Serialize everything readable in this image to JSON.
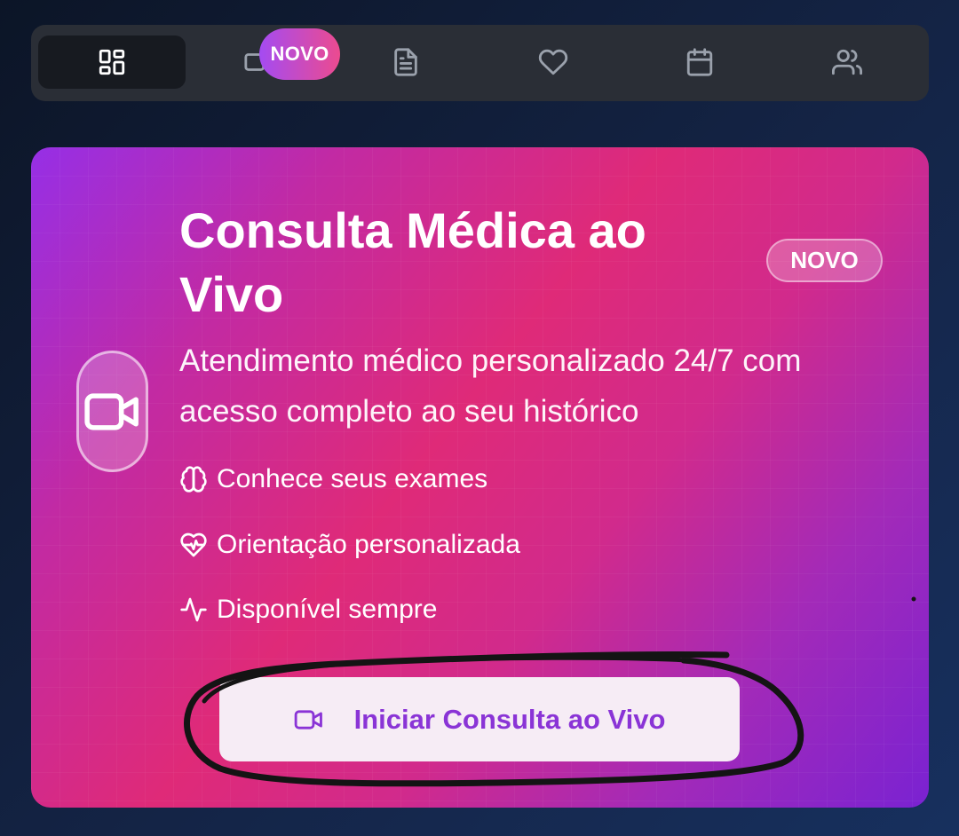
{
  "tabs": [
    {
      "id": "dashboard",
      "icon": "layout-grid-icon"
    },
    {
      "id": "video",
      "icon": "video-icon",
      "badge": "NOVO"
    },
    {
      "id": "documents",
      "icon": "file-text-icon"
    },
    {
      "id": "favorites",
      "icon": "heart-icon"
    },
    {
      "id": "calendar",
      "icon": "calendar-icon"
    },
    {
      "id": "users",
      "icon": "users-icon"
    }
  ],
  "active_tab": "dashboard",
  "nav_badge": "NOVO",
  "card": {
    "title": "Consulta Médica ao Vivo",
    "badge": "NOVO",
    "subtitle": "Atendimento médico personalizado 24/7 com acesso completo ao seu histórico",
    "features": [
      {
        "icon": "brain-icon",
        "label": "Conhece seus exames"
      },
      {
        "icon": "heart-pulse-icon",
        "label": "Orientação personalizada"
      },
      {
        "icon": "activity-icon",
        "label": "Disponível sempre"
      }
    ],
    "cta_label": "Iniciar Consulta ao Vivo",
    "cta_icon": "video-icon"
  },
  "colors": {
    "accent_purple": "#8a34d6",
    "card_pink": "#df2a78",
    "card_violet": "#962fe6",
    "tabbar_bg": "#2a2e36"
  }
}
